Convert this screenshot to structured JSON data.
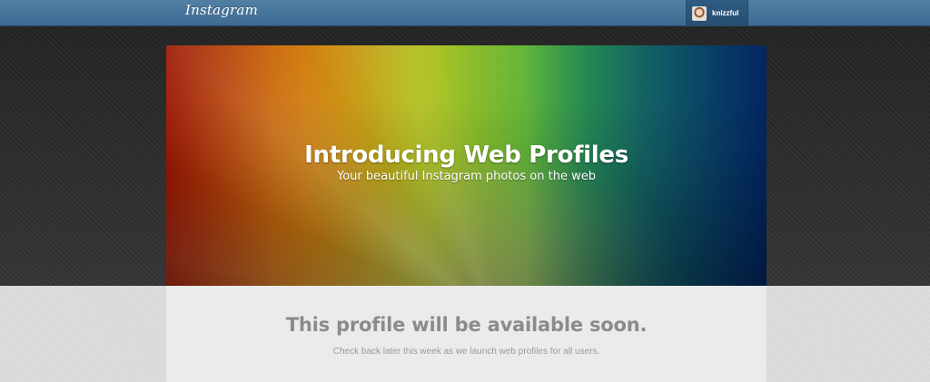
{
  "header": {
    "brand": "Instagram",
    "username": "knizzful"
  },
  "hero": {
    "title": "Introducing Web Profiles",
    "subtitle": "Your beautiful Instagram photos on the web"
  },
  "notice": {
    "title": "This profile will be available soon.",
    "text": "Check back later this week as we launch web profiles for all users."
  },
  "colors": {
    "topbar": "#517fa4",
    "notice_title": "#8b8b8b",
    "notice_text": "#9a9a9a",
    "panel_background": "#ebebeb"
  }
}
